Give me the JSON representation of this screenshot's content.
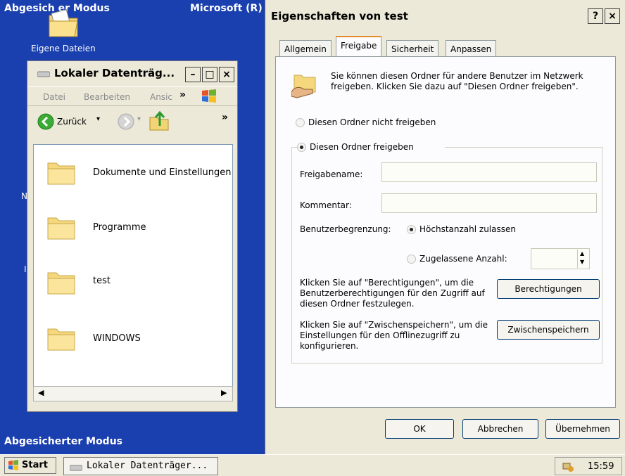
{
  "desktop": {
    "top_left_caption": "Abgesich    er Modus",
    "top_right_caption": "Microsoft (R)",
    "icon_label": "Eigene Dateien",
    "bottom_caption": "Abgesicherter Modus",
    "frag_n": "N",
    "frag_i": "I"
  },
  "explorer": {
    "title": "Lokaler Datenträg...",
    "menu": [
      "Datei",
      "Bearbeiten",
      "Ansic"
    ],
    "menu_more": "»",
    "back_label": "Zurück",
    "toolbar_more": "»",
    "items": [
      "Dokumente und Einstellungen",
      "Programme",
      "test",
      "WINDOWS"
    ]
  },
  "dialog": {
    "title": "Eigenschaften von test",
    "help_glyph": "?",
    "close_glyph": "×",
    "tabs": [
      "Allgemein",
      "Freigabe",
      "Sicherheit",
      "Anpassen"
    ],
    "active_tab": "Freigabe",
    "intro_text": "Sie können diesen Ordner für andere Benutzer im Netzwerk freigeben. Klicken Sie dazu auf \"Diesen Ordner freigeben\".",
    "radio_no_share": "Diesen Ordner nicht freigeben",
    "radio_share": "Diesen Ordner freigeben",
    "share_name_label": "Freigabename:",
    "share_name_value": "",
    "comment_label": "Kommentar:",
    "comment_value": "",
    "user_limit_label": "Benutzerbegrenzung:",
    "max_allowed": "Höchstanzahl zulassen",
    "allowed_count": "Zugelassene Anzahl:",
    "allowed_count_value": "",
    "permissions_text": "Klicken Sie auf \"Berechtigungen\", um die Benutzerberechtigungen für den Zugriff auf diesen Ordner festzulegen.",
    "permissions_button": "Berechtigungen",
    "caching_text": "Klicken Sie auf \"Zwischenspeichern\", um die Einstellungen für den Offlinezugriff zu konfigurieren.",
    "caching_button": "Zwischenspeichern",
    "ok_button": "OK",
    "cancel_button": "Abbrechen",
    "apply_button": "Übernehmen"
  },
  "taskbar": {
    "start_label": "Start",
    "task_label": "Lokaler Datenträger...",
    "clock": "15:59"
  }
}
